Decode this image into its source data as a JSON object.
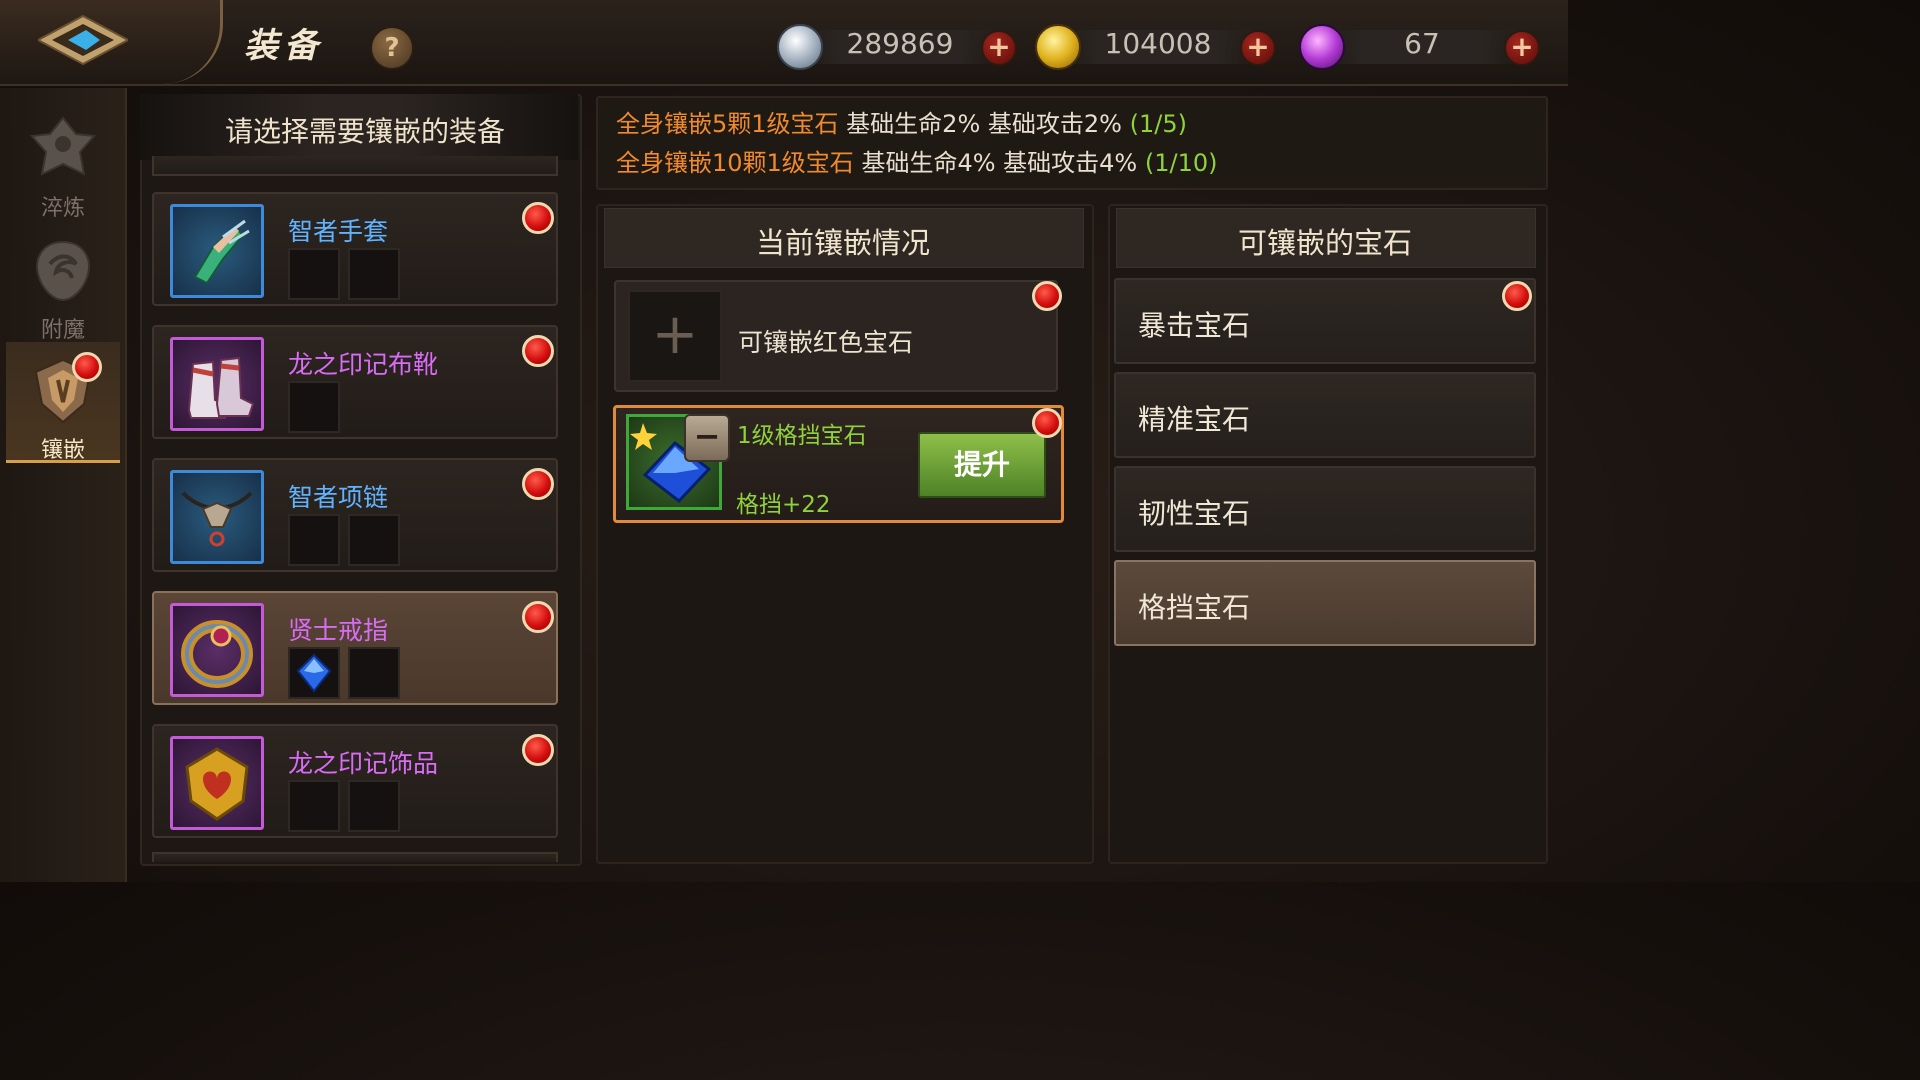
{
  "header": {
    "title": "装备",
    "help": "?",
    "currencies": [
      {
        "icon": "silver-coin-icon",
        "value": "289869",
        "plus": "+"
      },
      {
        "icon": "gold-coin-icon",
        "value": "104008",
        "plus": "+"
      },
      {
        "icon": "purple-gem-icon",
        "value": "67",
        "plus": "+"
      }
    ]
  },
  "side_tabs": [
    {
      "label": "淬炼",
      "icon": "temper-emblem-icon",
      "active": false
    },
    {
      "label": "附魔",
      "icon": "enchant-dragon-icon",
      "active": false
    },
    {
      "label": "镶嵌",
      "icon": "inlay-shield-icon",
      "active": true
    }
  ],
  "equip_list": {
    "title": "请选择需要镶嵌的装备",
    "items": [
      {
        "name": "智者手套",
        "rarity": "blue",
        "icon": "gloves-icon"
      },
      {
        "name": "龙之印记布靴",
        "rarity": "purple",
        "icon": "boots-icon"
      },
      {
        "name": "智者项链",
        "rarity": "blue",
        "icon": "necklace-icon"
      },
      {
        "name": "贤士戒指",
        "rarity": "purple",
        "icon": "ring-icon",
        "selected": true
      },
      {
        "name": "龙之印记饰品",
        "rarity": "purple",
        "icon": "trinket-icon"
      }
    ]
  },
  "bonus": {
    "line1": {
      "highlight": "全身镶嵌5颗1级宝石",
      "effect": " 基础生命2% 基础攻击2% ",
      "progress": "(1/5)"
    },
    "line2": {
      "highlight": "全身镶嵌10颗1级宝石",
      "effect": " 基础生命4% 基础攻击4% ",
      "progress": "(1/10)"
    }
  },
  "current_inlay": {
    "title": "当前镶嵌情况",
    "empty_slot": {
      "plus": "+",
      "label": "可镶嵌红色宝石"
    },
    "gem": {
      "name": "1级格挡宝石",
      "effect": "格挡+22",
      "minus": "−",
      "upgrade_label": "提升",
      "icon": "blue-gem-icon"
    }
  },
  "available_gems": {
    "title": "可镶嵌的宝石",
    "items": [
      {
        "label": "暴击宝石"
      },
      {
        "label": "精准宝石"
      },
      {
        "label": "韧性宝石"
      },
      {
        "label": "格挡宝石",
        "selected": true
      }
    ]
  },
  "colors": {
    "accent_orange": "#f08a2c",
    "progress_green": "#8ed23c",
    "blue_name": "#5fb3ff",
    "purple_name": "#d96cf5"
  }
}
